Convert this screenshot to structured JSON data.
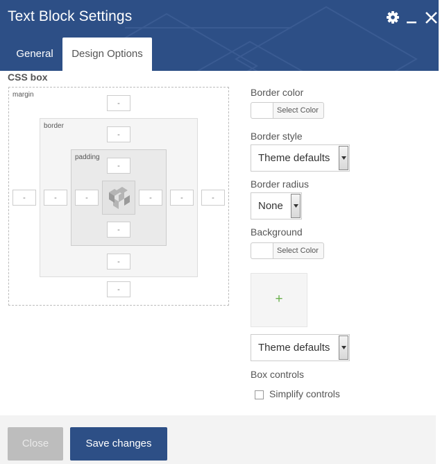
{
  "window": {
    "title": "Text Block Settings",
    "icons": [
      "gear-icon",
      "minimize-icon",
      "close-icon"
    ]
  },
  "tabs": [
    {
      "label": "General",
      "active": false
    },
    {
      "label": "Design Options",
      "active": true
    }
  ],
  "css_box": {
    "label": "CSS box",
    "margin_label": "margin",
    "border_label": "border",
    "padding_label": "padding",
    "placeholder": "-",
    "content_icon": "builder-logo-icon"
  },
  "options": {
    "border_color_label": "Border color",
    "border_color_button": "Select Color",
    "border_style_label": "Border style",
    "border_style_value": "Theme defaults",
    "border_radius_label": "Border radius",
    "border_radius_value": "None",
    "background_label": "Background",
    "background_button": "Select Color",
    "add_image_icon": "plus-icon",
    "add_image_symbol": "+",
    "background_style_value": "Theme defaults",
    "box_controls_label": "Box controls",
    "simplify_controls_label": "Simplify controls",
    "simplify_controls_checked": false
  },
  "footer": {
    "close_label": "Close",
    "save_label": "Save changes"
  },
  "colors": {
    "header": "#2d4f86",
    "save_button": "#2d4f86",
    "close_button": "#bdbdbd",
    "plus": "#6ab04c"
  }
}
